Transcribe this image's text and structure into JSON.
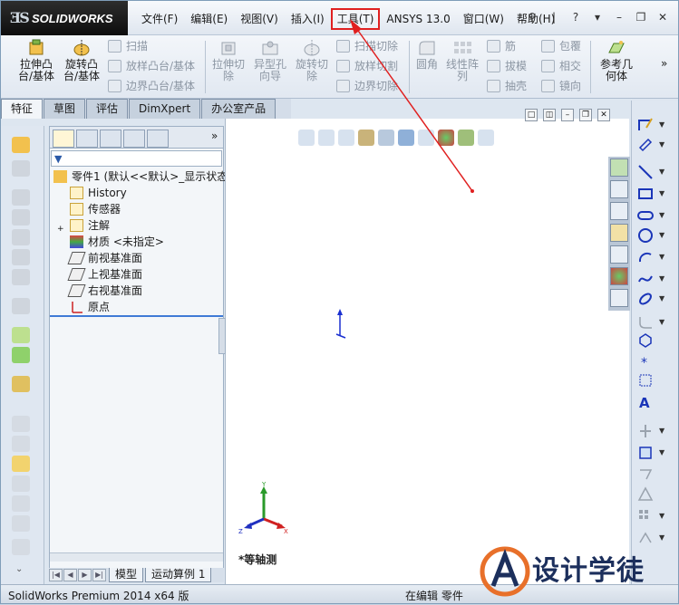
{
  "app": {
    "logo_text": "SOLIDWORKS",
    "status_left": "SolidWorks Premium 2014 x64 版",
    "status_mid": "在编辑 零件"
  },
  "menu": [
    {
      "label": "文件(F)"
    },
    {
      "label": "编辑(E)"
    },
    {
      "label": "视图(V)"
    },
    {
      "label": "插入(I)"
    },
    {
      "label": "工具(T)",
      "highlighted": true
    },
    {
      "label": "ANSYS 13.0"
    },
    {
      "label": "窗口(W)"
    },
    {
      "label": "帮助(H)"
    }
  ],
  "commands": {
    "extrude_boss": "拉伸凸\n台/基体",
    "revolve_boss": "旋转凸\n台/基体",
    "sweep": "扫描",
    "loft_boss": "放样凸台/基体",
    "boundary_boss": "边界凸台/基体",
    "extrude_cut": "拉伸切\n除",
    "hole_wizard": "异型孔\n向导",
    "revolve_cut": "旋转切\n除",
    "sweep_cut": "扫描切除",
    "loft_cut": "放样切割",
    "boundary_cut": "边界切除",
    "fillet": "圆角",
    "linear_pattern": "线性阵\n列",
    "rib": "筋",
    "draft": "拔模",
    "shell": "抽壳",
    "wrap": "包覆",
    "intersect": "相交",
    "mirror": "镜向",
    "reference_geometry": "参考几\n何体"
  },
  "tabs": [
    {
      "label": "特征",
      "active": true
    },
    {
      "label": "草图"
    },
    {
      "label": "评估"
    },
    {
      "label": "DimXpert"
    },
    {
      "label": "办公室产品"
    }
  ],
  "tree": {
    "root": "零件1 (默认<<默认>_显示状态",
    "items": [
      {
        "label": "History",
        "icon": "history-icon"
      },
      {
        "label": "传感器",
        "icon": "sensor-icon"
      },
      {
        "label": "注解",
        "icon": "annotation-icon"
      },
      {
        "label": "材质 <未指定>",
        "icon": "material-icon"
      },
      {
        "label": "前视基准面",
        "icon": "plane-icon"
      },
      {
        "label": "上视基准面",
        "icon": "plane-icon"
      },
      {
        "label": "右视基准面",
        "icon": "plane-icon"
      },
      {
        "label": "原点",
        "icon": "origin-icon"
      }
    ]
  },
  "bottom_tabs": [
    {
      "label": "模型"
    },
    {
      "label": "运动算例 1"
    }
  ],
  "graphics": {
    "view_label": "*等轴测"
  },
  "watermark": {
    "text": "设计学徒"
  },
  "colors": {
    "highlight": "#e02020",
    "arrow": "#e02020"
  }
}
